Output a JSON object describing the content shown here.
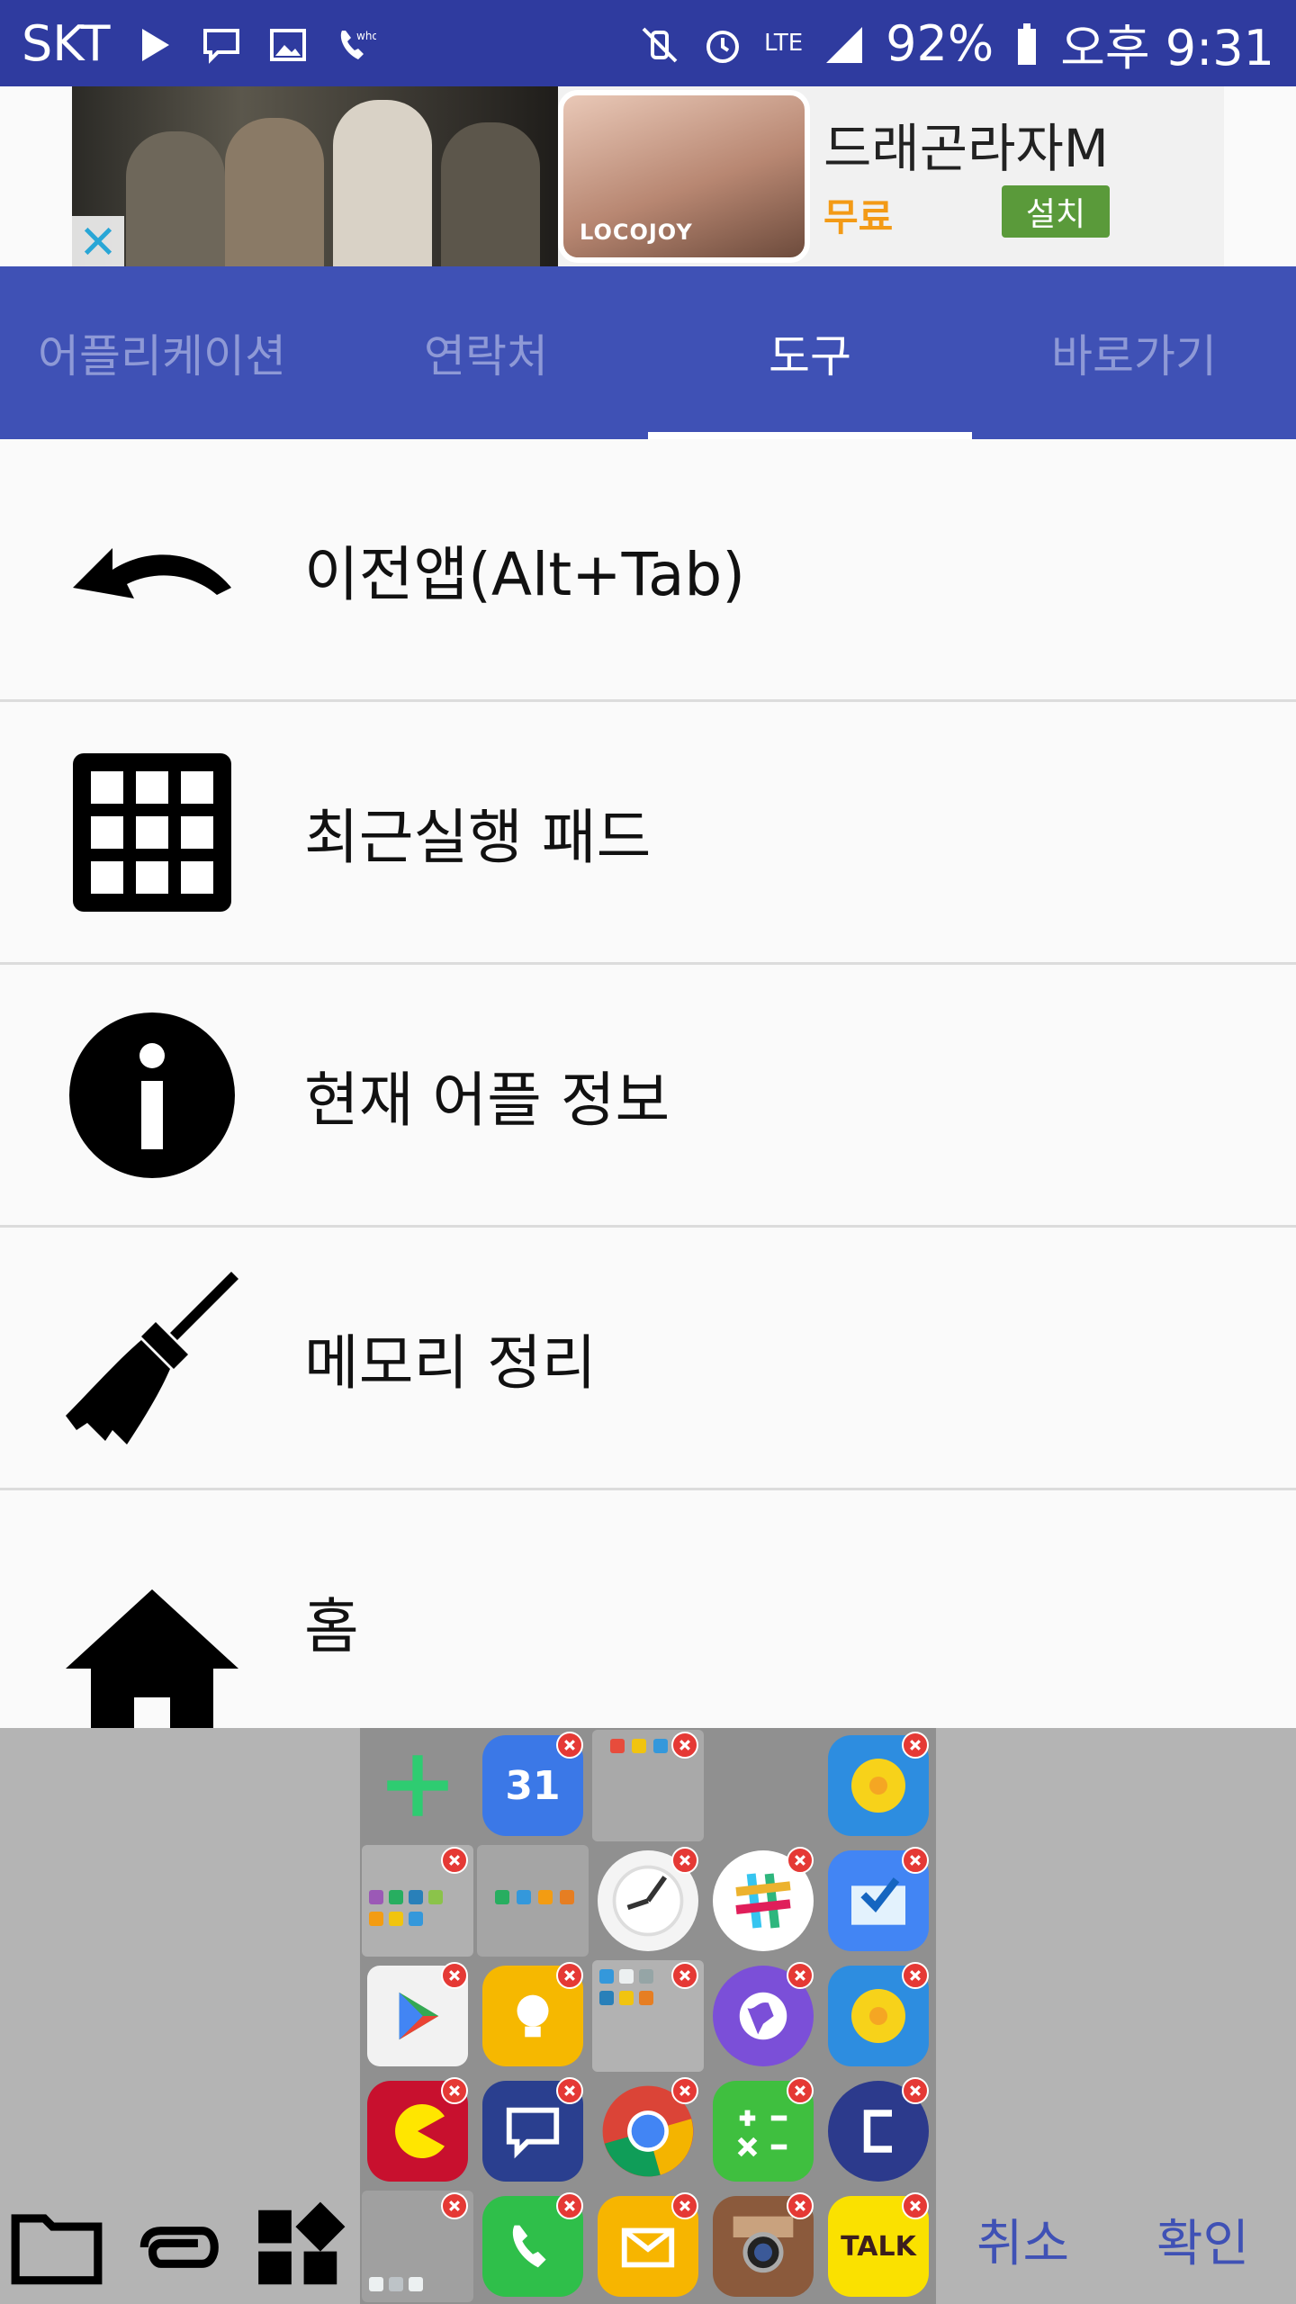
{
  "status_bar": {
    "carrier": "SKT",
    "battery": "92%",
    "time": "오후 9:31",
    "lte": "LTE"
  },
  "ad": {
    "title": "드래곤라자M",
    "price": "무료",
    "install_label": "설치",
    "brand": "LOCOJOY"
  },
  "tabs": [
    {
      "label": "어플리케이션",
      "active": false
    },
    {
      "label": "연락처",
      "active": false
    },
    {
      "label": "도구",
      "active": true
    },
    {
      "label": "바로가기",
      "active": false
    }
  ],
  "tools": [
    {
      "label": "이전앱(Alt+Tab)",
      "icon": "undo-arrow-icon"
    },
    {
      "label": "최근실행 패드",
      "icon": "grid-icon"
    },
    {
      "label": "현재 어플 정보",
      "icon": "info-icon"
    },
    {
      "label": "메모리 정리",
      "icon": "broom-icon"
    },
    {
      "label": "홈",
      "icon": "home-icon"
    }
  ],
  "app_grid": {
    "calendar_day": "31",
    "talk_label": "TALK"
  },
  "actions": {
    "cancel": "취소",
    "confirm": "확인"
  },
  "colors": {
    "status_bar": "#2f3b9f",
    "tab_bar": "#3f51b5",
    "tab_inactive_text": "#8e99d6",
    "ad_free": "#f39a16",
    "ad_install": "#5a9a3a",
    "action_text": "#3f51b5"
  }
}
